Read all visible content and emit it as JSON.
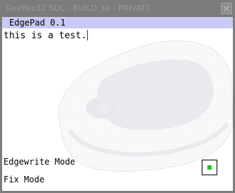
{
  "window": {
    "title": "GeePee32 SDL - BUILD 30 - PRIVATE"
  },
  "app": {
    "title": "EdgePad 0.1"
  },
  "editor": {
    "text": "this is a test."
  },
  "modes": {
    "edgewrite": "Edgewrite Mode",
    "fix": "Fix Mode"
  },
  "status": {
    "indicator_color": "#11cc11"
  },
  "icons": {
    "close": "close-icon",
    "background": "handheld-device-watermark"
  },
  "colors": {
    "header_band": "#c9c9f5",
    "titlebar": "#7b7b7b"
  }
}
